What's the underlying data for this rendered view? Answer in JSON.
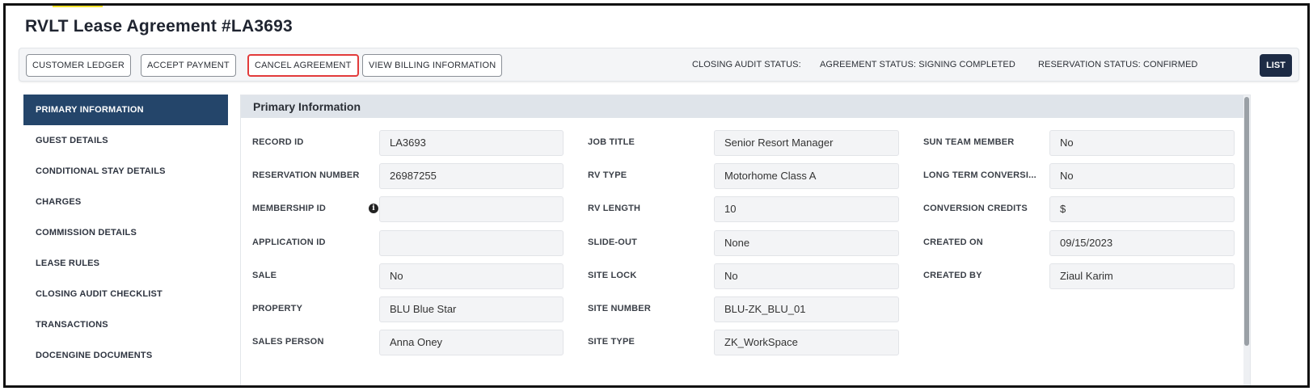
{
  "page": {
    "title": "RVLT Lease Agreement #LA3693"
  },
  "toolbar": {
    "buttons": [
      {
        "label": "CUSTOMER LEDGER"
      },
      {
        "label": "ACCEPT PAYMENT"
      },
      {
        "label": "CANCEL AGREEMENT",
        "highlighted": true
      },
      {
        "label": "VIEW BILLING INFORMATION"
      }
    ],
    "closing_audit_status": "CLOSING AUDIT STATUS:",
    "agreement_status": "AGREEMENT STATUS: SIGNING COMPLETED",
    "reservation_status": "RESERVATION STATUS: CONFIRMED",
    "list_label": "LIST"
  },
  "sidebar": {
    "items": [
      {
        "label": "PRIMARY INFORMATION",
        "active": true
      },
      {
        "label": "GUEST DETAILS"
      },
      {
        "label": "CONDITIONAL STAY DETAILS"
      },
      {
        "label": "CHARGES"
      },
      {
        "label": "COMMISSION DETAILS"
      },
      {
        "label": "LEASE RULES"
      },
      {
        "label": "CLOSING AUDIT CHECKLIST"
      },
      {
        "label": "TRANSACTIONS"
      },
      {
        "label": "DOCENGINE DOCUMENTS"
      }
    ]
  },
  "panel": {
    "title": "Primary Information",
    "col1": [
      {
        "label": "RECORD ID",
        "value": "LA3693"
      },
      {
        "label": "RESERVATION NUMBER",
        "value": "26987255"
      },
      {
        "label": "MEMBERSHIP ID",
        "value": "",
        "icon": "info-icon"
      },
      {
        "label": "APPLICATION ID",
        "value": ""
      },
      {
        "label": "SALE",
        "value": "No"
      },
      {
        "label": "PROPERTY",
        "value": "BLU Blue Star"
      },
      {
        "label": "SALES PERSON",
        "value": "Anna Oney"
      }
    ],
    "col2": [
      {
        "label": "JOB TITLE",
        "value": "Senior Resort Manager"
      },
      {
        "label": "RV TYPE",
        "value": "Motorhome Class A"
      },
      {
        "label": "RV LENGTH",
        "value": "10"
      },
      {
        "label": "SLIDE-OUT",
        "value": "None"
      },
      {
        "label": "SITE LOCK",
        "value": "No"
      },
      {
        "label": "SITE NUMBER",
        "value": "BLU-ZK_BLU_01"
      },
      {
        "label": "SITE TYPE",
        "value": "ZK_WorkSpace"
      }
    ],
    "col3": [
      {
        "label": "SUN TEAM MEMBER",
        "value": "No"
      },
      {
        "label": "LONG TERM CONVERSI...",
        "value": "No"
      },
      {
        "label": "CONVERSION CREDITS",
        "value": "$"
      },
      {
        "label": "CREATED ON",
        "value": "09/15/2023"
      },
      {
        "label": "CREATED BY",
        "value": "Ziaul Karim"
      }
    ]
  },
  "colors": {
    "accent": "#24456a",
    "list_button": "#1d2b45",
    "highlight_border": "#e23b3b",
    "highlight_marker": "#f5e22a"
  }
}
